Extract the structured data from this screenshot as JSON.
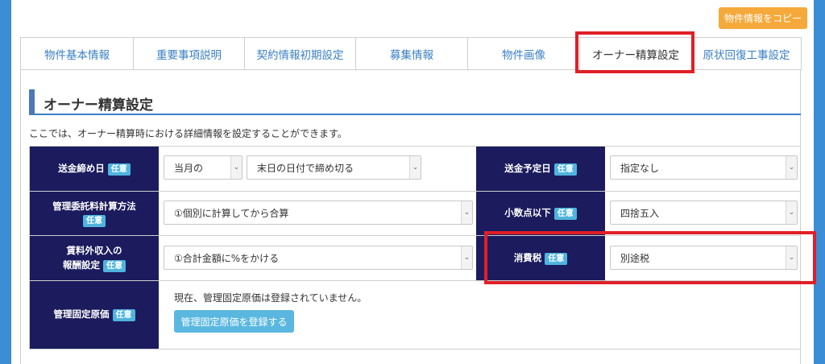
{
  "toolbar": {
    "copy_label": "物件情報をコピー"
  },
  "tabs": [
    {
      "label": "物件基本情報"
    },
    {
      "label": "重要事項説明"
    },
    {
      "label": "契約情報初期設定"
    },
    {
      "label": "募集情報"
    },
    {
      "label": "物件画像"
    },
    {
      "label": "オーナー精算設定"
    },
    {
      "label": "原状回復工事設定"
    }
  ],
  "section": {
    "title": "オーナー精算設定",
    "description": "ここでは、オーナー精算時における詳細情報を設定することができます。"
  },
  "badge": "任意",
  "fields": {
    "remit_close": {
      "label": "送金締め日",
      "month_value": "当月の",
      "day_value": "末日の日付で締め切る"
    },
    "remit_date": {
      "label": "送金予定日",
      "value": "指定なし"
    },
    "fee_method": {
      "label": "管理委託料計算方法",
      "value": "①個別に計算してから合算"
    },
    "decimal": {
      "label": "小数点以下",
      "value": "四捨五入"
    },
    "non_rent": {
      "label_line1": "賃料外収入の",
      "label_line2": "報酬設定",
      "value": "①合計金額に%をかける"
    },
    "tax": {
      "label": "消費税",
      "value": "別途税"
    },
    "fixed_cost": {
      "label": "管理固定原価",
      "status": "現在、管理固定原価は登録されていません。",
      "button": "管理固定原価を登録する"
    }
  },
  "arrow_glyph": "⌄",
  "colors": {
    "frame": "#3b8dd6",
    "label_bg": "#1b1b5e",
    "badge": "#4fb4de",
    "highlight": "#e01f26",
    "copy_btn": "#f6a93b"
  }
}
